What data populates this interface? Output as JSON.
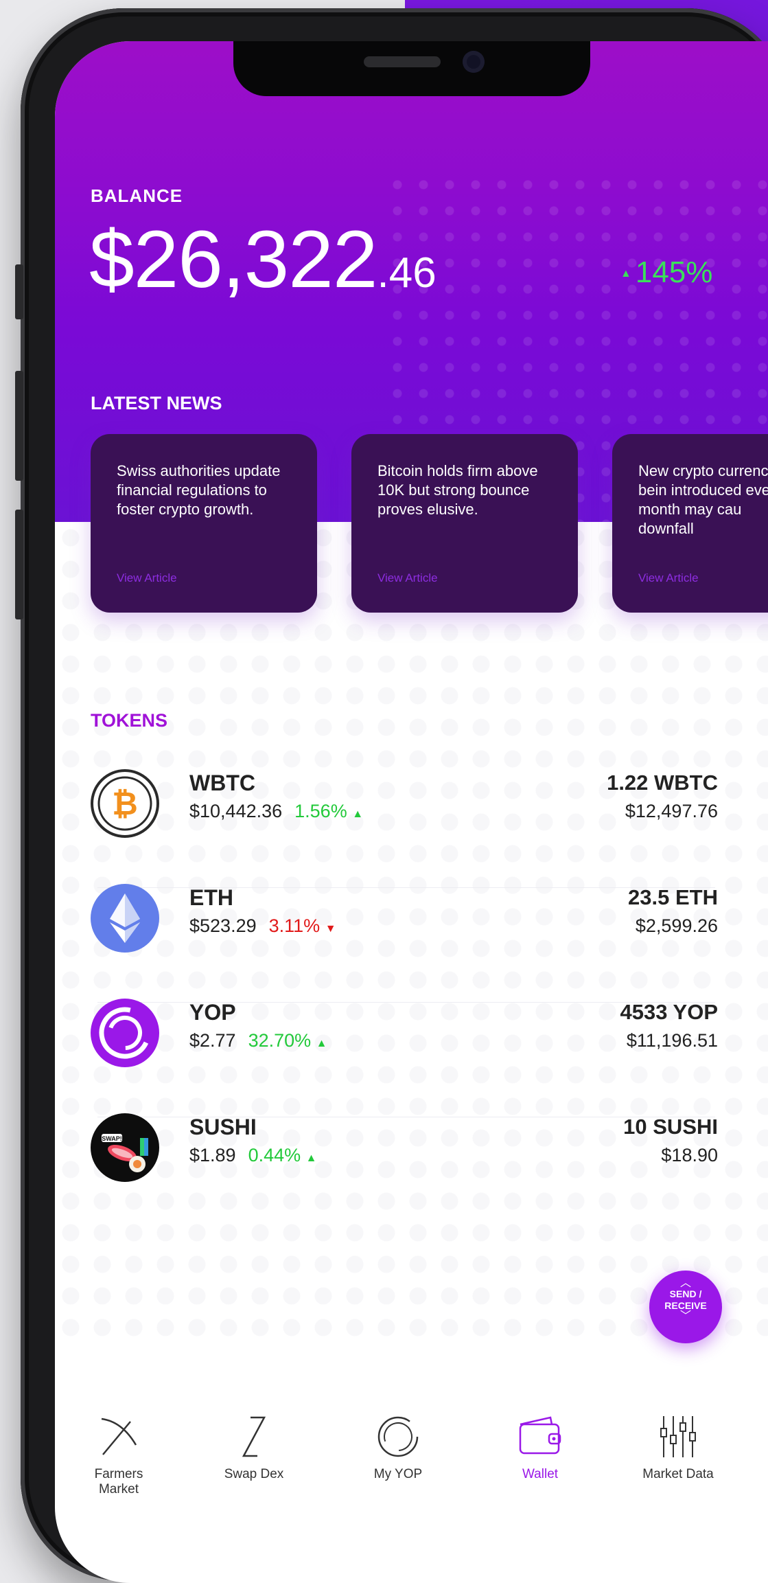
{
  "balance": {
    "label": "BALANCE",
    "whole": "$26,322",
    "cents": ".46",
    "change": "145%",
    "change_color": "#3be05a"
  },
  "news": {
    "label": "LATEST NEWS",
    "items": [
      {
        "text": "Swiss authorities update financial regulations to foster crypto growth.",
        "link": "View Article"
      },
      {
        "text": "Bitcoin holds firm above 10K but strong bounce proves elusive.",
        "link": "View Article"
      },
      {
        "text": "New crypto currencies bein introduced eve month may cau downfall",
        "link": "View Article"
      }
    ]
  },
  "tokens": {
    "label": "TOKENS",
    "items": [
      {
        "symbol": "WBTC",
        "price": "$10,442.36",
        "change": "1.56%",
        "direction": "up",
        "amount": "1.22 WBTC",
        "value": "$12,497.76",
        "icon": "bitcoin-icon"
      },
      {
        "symbol": "ETH",
        "price": "$523.29",
        "change": "3.11%",
        "direction": "down",
        "amount": "23.5 ETH",
        "value": "$2,599.26",
        "icon": "ethereum-icon"
      },
      {
        "symbol": "YOP",
        "price": "$2.77",
        "change": "32.70%",
        "direction": "up",
        "amount": "4533 YOP",
        "value": "$11,196.51",
        "icon": "yop-icon"
      },
      {
        "symbol": "SUSHI",
        "price": "$1.89",
        "change": "0.44%",
        "direction": "up",
        "amount": "10 SUSHI",
        "value": "$18.90",
        "icon": "sushi-icon"
      }
    ]
  },
  "fab": {
    "line1": "SEND /",
    "line2": "RECEIVE"
  },
  "nav": [
    {
      "label": "Farmers Market",
      "icon": "pickaxe-icon"
    },
    {
      "label": "Swap Dex",
      "icon": "swap-icon"
    },
    {
      "label": "My YOP",
      "icon": "yop-ring-icon"
    },
    {
      "label": "Wallet",
      "icon": "wallet-icon",
      "active": true
    },
    {
      "label": "Market Data",
      "icon": "sliders-icon"
    }
  ],
  "colors": {
    "accent": "#9a18e8",
    "up": "#22c93a",
    "down": "#e11a1a",
    "card": "#3a1155"
  }
}
